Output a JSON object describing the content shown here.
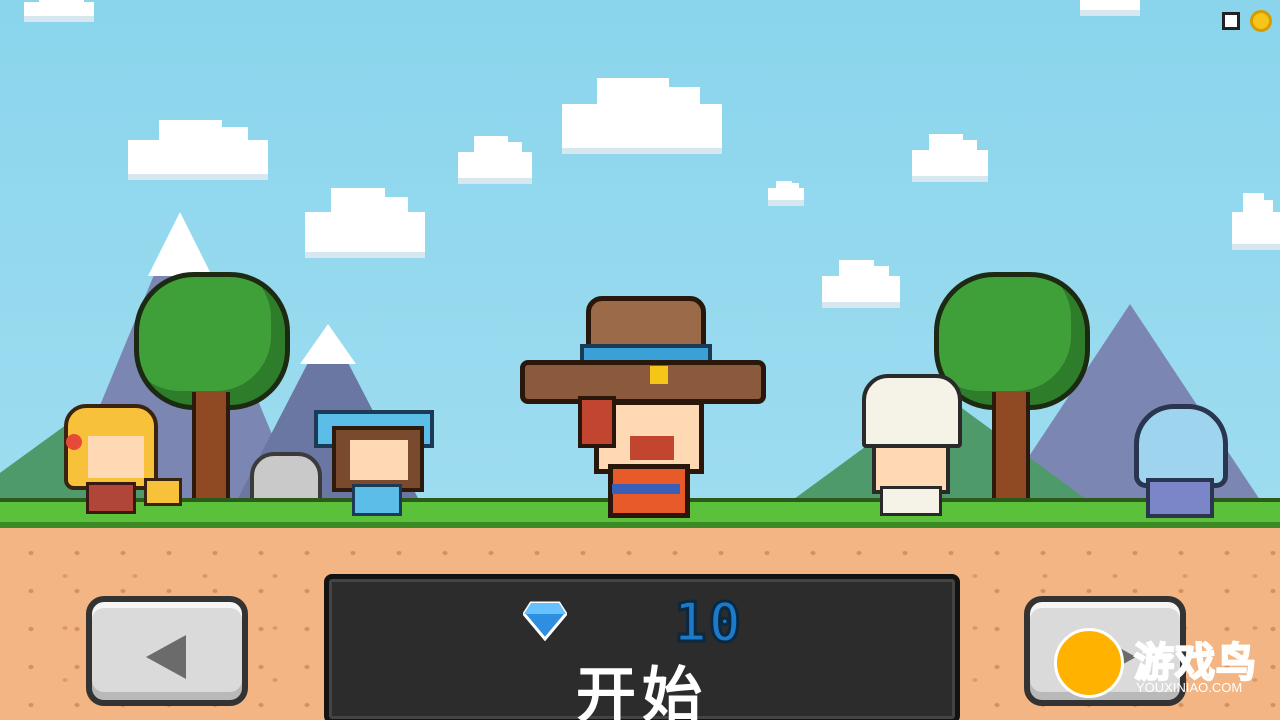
{
  "hud": {
    "gem_count": "10",
    "start_label": "开始",
    "gem_icon": "diamond-gem-icon",
    "prev_icon": "left-arrow-icon",
    "next_icon": "right-arrow-icon"
  },
  "corner_icons": [
    "window-icon",
    "coin-icon"
  ],
  "characters": [
    "blonde-girl",
    "blue-bandana-girl",
    "cowboy",
    "chef",
    "astronaut"
  ],
  "watermark": {
    "title": "游戏鸟",
    "url": "YOUXINIAO.COM"
  },
  "colors": {
    "sky": "#8ad5ec",
    "grass": "#5cc13a",
    "dirt": "#f2b583",
    "panel": "#2c2c2c",
    "gem_blue": "#1d79c9"
  }
}
